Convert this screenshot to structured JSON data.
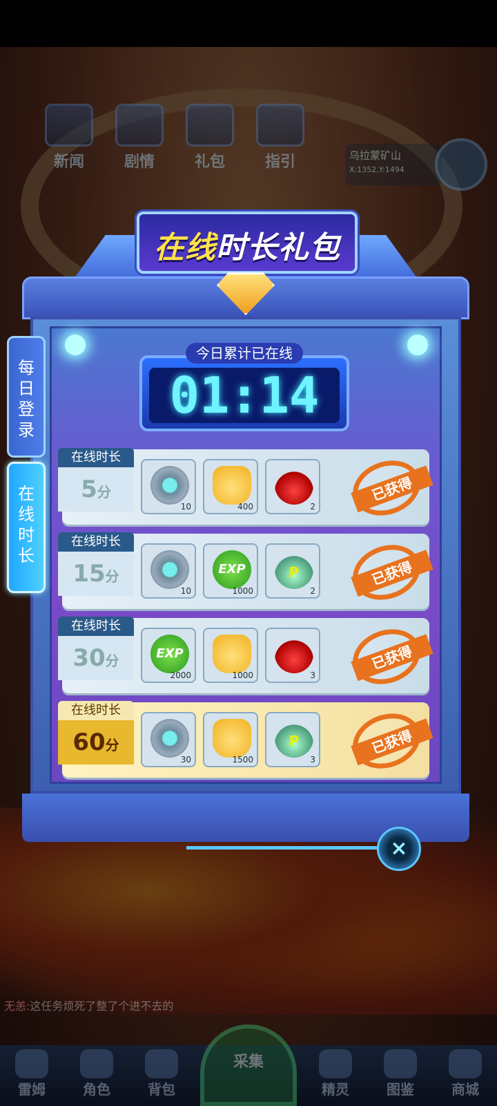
{
  "hud": {
    "buttons": [
      "新闻",
      "剧情",
      "礼包",
      "指引"
    ],
    "location": {
      "name": "乌拉蒙矿山",
      "coords": "X:1352,Y:1494"
    }
  },
  "chat": {
    "name": "无恙:",
    "message": "这任务烦死了整了个进不去的"
  },
  "nav": {
    "items": [
      "雷姆",
      "角色",
      "背包",
      "采集",
      "精灵",
      "图鉴",
      "商城"
    ]
  },
  "panel": {
    "title_part1": "在线",
    "title_part2": "时长礼包",
    "timer_label": "今日累计已在线",
    "timer_value": "01:14",
    "tabs": {
      "daily_login": "每日登录",
      "online_time": "在线时长"
    },
    "rows": [
      {
        "header": "在线时长",
        "minutes": "5",
        "unit": "分",
        "status": "已获得",
        "items": [
          {
            "icon": "energy-icon",
            "count": "10"
          },
          {
            "icon": "cat-coin-icon",
            "count": "400"
          },
          {
            "icon": "red-potion-icon",
            "count": "2"
          }
        ]
      },
      {
        "header": "在线时长",
        "minutes": "15",
        "unit": "分",
        "status": "已获得",
        "items": [
          {
            "icon": "energy-icon",
            "count": "10"
          },
          {
            "icon": "exp-orb-icon",
            "count": "1000"
          },
          {
            "icon": "p-potion-icon",
            "count": "2"
          }
        ]
      },
      {
        "header": "在线时长",
        "minutes": "30",
        "unit": "分",
        "status": "已获得",
        "items": [
          {
            "icon": "exp-orb-icon",
            "count": "2000"
          },
          {
            "icon": "cat-coin-icon",
            "count": "1000"
          },
          {
            "icon": "red-potion-icon",
            "count": "3"
          }
        ]
      },
      {
        "header": "在线时长",
        "minutes": "60",
        "unit": "分",
        "status": "已获得",
        "items": [
          {
            "icon": "energy-icon",
            "count": "30"
          },
          {
            "icon": "cat-coin-icon",
            "count": "1500"
          },
          {
            "icon": "p-potion-icon",
            "count": "3"
          }
        ]
      }
    ],
    "close_glyph": "×"
  },
  "colors": {
    "accent": "#5ac8ff",
    "claimed": "#e8721e",
    "timer": "#6ff3ff"
  }
}
